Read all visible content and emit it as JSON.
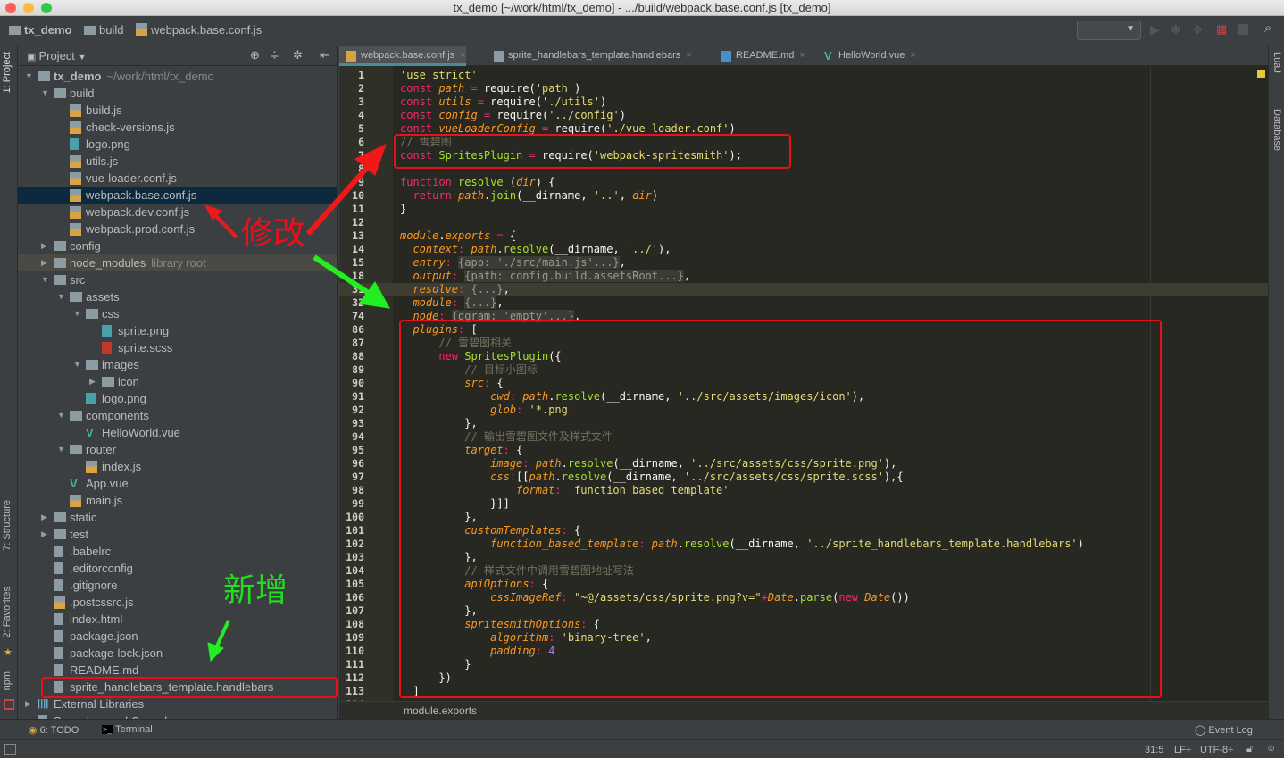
{
  "window": {
    "title": "tx_demo [~/work/html/tx_demo] - .../build/webpack.base.conf.js [tx_demo]"
  },
  "navbar": {
    "crumbs": [
      "tx_demo",
      "build",
      "webpack.base.conf.js"
    ]
  },
  "project": {
    "title": "Project",
    "items": [
      {
        "level": 0,
        "type": "folder",
        "open": true,
        "label": "tx_demo",
        "suffix": "~/work/html/tx_demo",
        "bold": true
      },
      {
        "level": 1,
        "type": "folder",
        "open": true,
        "label": "build"
      },
      {
        "level": 2,
        "type": "js",
        "label": "build.js"
      },
      {
        "level": 2,
        "type": "js",
        "label": "check-versions.js"
      },
      {
        "level": 2,
        "type": "img",
        "label": "logo.png"
      },
      {
        "level": 2,
        "type": "js",
        "label": "utils.js"
      },
      {
        "level": 2,
        "type": "js",
        "label": "vue-loader.conf.js"
      },
      {
        "level": 2,
        "type": "js",
        "label": "webpack.base.conf.js",
        "selected": true
      },
      {
        "level": 2,
        "type": "js",
        "label": "webpack.dev.conf.js"
      },
      {
        "level": 2,
        "type": "js",
        "label": "webpack.prod.conf.js"
      },
      {
        "level": 1,
        "type": "folder",
        "open": false,
        "label": "config"
      },
      {
        "level": 1,
        "type": "folder",
        "open": false,
        "label": "node_modules",
        "suffix": "library root",
        "lib": true
      },
      {
        "level": 1,
        "type": "folder",
        "open": true,
        "label": "src"
      },
      {
        "level": 2,
        "type": "folder",
        "open": true,
        "label": "assets"
      },
      {
        "level": 3,
        "type": "folder",
        "open": true,
        "label": "css"
      },
      {
        "level": 4,
        "type": "img",
        "label": "sprite.png"
      },
      {
        "level": 4,
        "type": "scss",
        "label": "sprite.scss"
      },
      {
        "level": 3,
        "type": "folder",
        "open": true,
        "label": "images"
      },
      {
        "level": 4,
        "type": "folder",
        "open": false,
        "label": "icon"
      },
      {
        "level": 3,
        "type": "img",
        "label": "logo.png"
      },
      {
        "level": 2,
        "type": "folder",
        "open": true,
        "label": "components"
      },
      {
        "level": 3,
        "type": "vue",
        "label": "HelloWorld.vue"
      },
      {
        "level": 2,
        "type": "folder",
        "open": true,
        "label": "router"
      },
      {
        "level": 3,
        "type": "js",
        "label": "index.js"
      },
      {
        "level": 2,
        "type": "vue",
        "label": "App.vue"
      },
      {
        "level": 2,
        "type": "js",
        "label": "main.js"
      },
      {
        "level": 1,
        "type": "folder",
        "open": false,
        "label": "static"
      },
      {
        "level": 1,
        "type": "folder",
        "open": false,
        "label": "test"
      },
      {
        "level": 1,
        "type": "file",
        "label": ".babelrc"
      },
      {
        "level": 1,
        "type": "file",
        "label": ".editorconfig"
      },
      {
        "level": 1,
        "type": "file",
        "label": ".gitignore"
      },
      {
        "level": 1,
        "type": "js",
        "label": ".postcssrc.js"
      },
      {
        "level": 1,
        "type": "file",
        "label": "index.html"
      },
      {
        "level": 1,
        "type": "file",
        "label": "package.json"
      },
      {
        "level": 1,
        "type": "file",
        "label": "package-lock.json"
      },
      {
        "level": 1,
        "type": "file",
        "label": "README.md"
      },
      {
        "level": 1,
        "type": "file",
        "label": "sprite_handlebars_template.handlebars"
      },
      {
        "level": 0,
        "type": "lib",
        "open": false,
        "label": "External Libraries"
      },
      {
        "level": 0,
        "type": "file",
        "label": "Scratches and Consoles"
      }
    ]
  },
  "tabs": [
    {
      "label": "webpack.base.conf.js",
      "active": true
    },
    {
      "label": "sprite_handlebars_template.handlebars"
    },
    {
      "label": "README.md"
    },
    {
      "label": "HelloWorld.vue"
    }
  ],
  "code": [
    {
      "n": "1",
      "t": [
        [
          "s",
          "'use strict'"
        ]
      ]
    },
    {
      "n": "2",
      "t": [
        [
          "k",
          "const "
        ],
        [
          "v",
          "path"
        ],
        [
          "o",
          " = "
        ],
        [
          "t",
          "require("
        ],
        [
          "s",
          "'path'"
        ],
        [
          "t",
          ")"
        ]
      ]
    },
    {
      "n": "3",
      "t": [
        [
          "k",
          "const "
        ],
        [
          "v",
          "utils"
        ],
        [
          "o",
          " = "
        ],
        [
          "t",
          "require("
        ],
        [
          "s",
          "'./utils'"
        ],
        [
          "t",
          ")"
        ]
      ]
    },
    {
      "n": "4",
      "t": [
        [
          "k",
          "const "
        ],
        [
          "v",
          "config"
        ],
        [
          "o",
          " = "
        ],
        [
          "t",
          "require("
        ],
        [
          "s",
          "'../config'"
        ],
        [
          "t",
          ")"
        ]
      ]
    },
    {
      "n": "5",
      "t": [
        [
          "k",
          "const "
        ],
        [
          "v",
          "vueLoaderConfig"
        ],
        [
          "o",
          " = "
        ],
        [
          "t",
          "require("
        ],
        [
          "s",
          "'./vue-loader.conf'"
        ],
        [
          "t",
          ")"
        ]
      ]
    },
    {
      "n": "6",
      "t": [
        [
          "c",
          "// 雪碧图"
        ]
      ]
    },
    {
      "n": "7",
      "t": [
        [
          "k",
          "const "
        ],
        [
          "cls",
          "SpritesPlugin"
        ],
        [
          "o",
          " = "
        ],
        [
          "t",
          "require("
        ],
        [
          "s",
          "'webpack-spritesmith'"
        ],
        [
          "t",
          ");"
        ]
      ]
    },
    {
      "n": "8",
      "t": []
    },
    {
      "n": "9",
      "t": [
        [
          "k",
          "function "
        ],
        [
          "f",
          "resolve "
        ],
        [
          "t",
          "("
        ],
        [
          "v",
          "dir"
        ],
        [
          "t",
          ") {"
        ]
      ]
    },
    {
      "n": "10",
      "t": [
        [
          "t",
          "  "
        ],
        [
          "k",
          "return "
        ],
        [
          "v",
          "path"
        ],
        [
          "t",
          "."
        ],
        [
          "f",
          "join"
        ],
        [
          "t",
          "(__dirname, "
        ],
        [
          "s",
          "'..'"
        ],
        [
          "t",
          ", "
        ],
        [
          "v",
          "dir"
        ],
        [
          "t",
          ")"
        ]
      ]
    },
    {
      "n": "11",
      "t": [
        [
          "t",
          "}"
        ]
      ]
    },
    {
      "n": "12",
      "t": []
    },
    {
      "n": "13",
      "t": [
        [
          "v",
          "module"
        ],
        [
          "t",
          "."
        ],
        [
          "v",
          "exports"
        ],
        [
          "o",
          " = "
        ],
        [
          "t",
          "{"
        ]
      ]
    },
    {
      "n": "14",
      "t": [
        [
          "t",
          "  "
        ],
        [
          "p",
          "context"
        ],
        [
          "o",
          ": "
        ],
        [
          "v",
          "path"
        ],
        [
          "t",
          "."
        ],
        [
          "f",
          "resolve"
        ],
        [
          "t",
          "(__dirname, "
        ],
        [
          "s",
          "'../'"
        ],
        [
          "t",
          "),"
        ]
      ]
    },
    {
      "n": "15",
      "t": [
        [
          "t",
          "  "
        ],
        [
          "p",
          "entry"
        ],
        [
          "o",
          ": "
        ],
        [
          "fd",
          "{app: './src/main.js'...}"
        ],
        [
          "t",
          ","
        ]
      ]
    },
    {
      "n": "18",
      "t": [
        [
          "t",
          "  "
        ],
        [
          "p",
          "output"
        ],
        [
          "o",
          ": "
        ],
        [
          "fd",
          "{path: config.build.assetsRoot...}"
        ],
        [
          "t",
          ","
        ]
      ]
    },
    {
      "n": "31",
      "cur": true,
      "t": [
        [
          "t",
          "  "
        ],
        [
          "p",
          "resolve"
        ],
        [
          "o",
          ": "
        ],
        [
          "fd",
          "{...}"
        ],
        [
          "t",
          ","
        ]
      ]
    },
    {
      "n": "32",
      "t": [
        [
          "t",
          "  "
        ],
        [
          "p",
          "module"
        ],
        [
          "o",
          ": "
        ],
        [
          "fd",
          "{...}"
        ],
        [
          "t",
          ","
        ]
      ]
    },
    {
      "n": "74",
      "t": [
        [
          "t",
          "  "
        ],
        [
          "p",
          "node"
        ],
        [
          "o",
          ": "
        ],
        [
          "fd",
          "{dgram: 'empty'...}"
        ],
        [
          "t",
          ","
        ]
      ]
    },
    {
      "n": "86",
      "t": [
        [
          "t",
          "  "
        ],
        [
          "p",
          "plugins"
        ],
        [
          "o",
          ": "
        ],
        [
          "t",
          "["
        ]
      ]
    },
    {
      "n": "87",
      "t": [
        [
          "t",
          "      "
        ],
        [
          "c",
          "// 雪碧图相关"
        ]
      ]
    },
    {
      "n": "88",
      "t": [
        [
          "t",
          "      "
        ],
        [
          "k",
          "new "
        ],
        [
          "cls",
          "SpritesPlugin"
        ],
        [
          "t",
          "({"
        ]
      ]
    },
    {
      "n": "89",
      "t": [
        [
          "t",
          "          "
        ],
        [
          "c",
          "// 目标小图标"
        ]
      ]
    },
    {
      "n": "90",
      "t": [
        [
          "t",
          "          "
        ],
        [
          "p",
          "src"
        ],
        [
          "o",
          ": "
        ],
        [
          "t",
          "{"
        ]
      ]
    },
    {
      "n": "91",
      "t": [
        [
          "t",
          "              "
        ],
        [
          "p",
          "cwd"
        ],
        [
          "o",
          ": "
        ],
        [
          "v",
          "path"
        ],
        [
          "t",
          "."
        ],
        [
          "f",
          "resolve"
        ],
        [
          "t",
          "(__dirname, "
        ],
        [
          "s",
          "'../src/assets/images/icon'"
        ],
        [
          "t",
          "),"
        ]
      ]
    },
    {
      "n": "92",
      "t": [
        [
          "t",
          "              "
        ],
        [
          "p",
          "glob"
        ],
        [
          "o",
          ": "
        ],
        [
          "s",
          "'*.png'"
        ]
      ]
    },
    {
      "n": "93",
      "t": [
        [
          "t",
          "          },"
        ]
      ]
    },
    {
      "n": "94",
      "t": [
        [
          "t",
          "          "
        ],
        [
          "c",
          "// 输出雪碧图文件及样式文件"
        ]
      ]
    },
    {
      "n": "95",
      "t": [
        [
          "t",
          "          "
        ],
        [
          "p",
          "target"
        ],
        [
          "o",
          ": "
        ],
        [
          "t",
          "{"
        ]
      ]
    },
    {
      "n": "96",
      "t": [
        [
          "t",
          "              "
        ],
        [
          "p",
          "image"
        ],
        [
          "o",
          ": "
        ],
        [
          "v",
          "path"
        ],
        [
          "t",
          "."
        ],
        [
          "f",
          "resolve"
        ],
        [
          "t",
          "(__dirname, "
        ],
        [
          "s",
          "'../src/assets/css/sprite.png'"
        ],
        [
          "t",
          "),"
        ]
      ]
    },
    {
      "n": "97",
      "t": [
        [
          "t",
          "              "
        ],
        [
          "p",
          "css"
        ],
        [
          "o",
          ":"
        ],
        [
          "t",
          "[["
        ],
        [
          "v",
          "path"
        ],
        [
          "t",
          "."
        ],
        [
          "f",
          "resolve"
        ],
        [
          "t",
          "(__dirname, "
        ],
        [
          "s",
          "'../src/assets/css/sprite.scss'"
        ],
        [
          "t",
          "),{"
        ]
      ]
    },
    {
      "n": "98",
      "t": [
        [
          "t",
          "                  "
        ],
        [
          "p",
          "format"
        ],
        [
          "o",
          ": "
        ],
        [
          "s",
          "'function_based_template'"
        ]
      ]
    },
    {
      "n": "99",
      "t": [
        [
          "t",
          "              }]]"
        ]
      ]
    },
    {
      "n": "100",
      "t": [
        [
          "t",
          "          },"
        ]
      ]
    },
    {
      "n": "101",
      "t": [
        [
          "t",
          "          "
        ],
        [
          "p",
          "customTemplates"
        ],
        [
          "o",
          ": "
        ],
        [
          "t",
          "{"
        ]
      ]
    },
    {
      "n": "102",
      "t": [
        [
          "t",
          "              "
        ],
        [
          "p",
          "function_based_template"
        ],
        [
          "o",
          ": "
        ],
        [
          "v",
          "path"
        ],
        [
          "t",
          "."
        ],
        [
          "f",
          "resolve"
        ],
        [
          "t",
          "(__dirname, "
        ],
        [
          "s",
          "'../sprite_handlebars_template.handlebars'"
        ],
        [
          "t",
          ")"
        ]
      ]
    },
    {
      "n": "103",
      "t": [
        [
          "t",
          "          },"
        ]
      ]
    },
    {
      "n": "104",
      "t": [
        [
          "t",
          "          "
        ],
        [
          "c",
          "// 样式文件中调用雪碧图地址写法"
        ]
      ]
    },
    {
      "n": "105",
      "t": [
        [
          "t",
          "          "
        ],
        [
          "p",
          "apiOptions"
        ],
        [
          "o",
          ": "
        ],
        [
          "t",
          "{"
        ]
      ]
    },
    {
      "n": "106",
      "t": [
        [
          "t",
          "              "
        ],
        [
          "p",
          "cssImageRef"
        ],
        [
          "o",
          ": "
        ],
        [
          "s",
          "\"~@/assets/css/sprite.png?v=\""
        ],
        [
          "o",
          "+"
        ],
        [
          "v",
          "Date"
        ],
        [
          "t",
          "."
        ],
        [
          "f",
          "parse"
        ],
        [
          "t",
          "("
        ],
        [
          "k",
          "new "
        ],
        [
          "v",
          "Date"
        ],
        [
          "t",
          "())"
        ]
      ]
    },
    {
      "n": "107",
      "t": [
        [
          "t",
          "          },"
        ]
      ]
    },
    {
      "n": "108",
      "t": [
        [
          "t",
          "          "
        ],
        [
          "p",
          "spritesmithOptions"
        ],
        [
          "o",
          ": "
        ],
        [
          "t",
          "{"
        ]
      ]
    },
    {
      "n": "109",
      "t": [
        [
          "t",
          "              "
        ],
        [
          "p",
          "algorithm"
        ],
        [
          "o",
          ": "
        ],
        [
          "s",
          "'binary-tree'"
        ],
        [
          "t",
          ","
        ]
      ]
    },
    {
      "n": "110",
      "t": [
        [
          "t",
          "              "
        ],
        [
          "p",
          "padding"
        ],
        [
          "o",
          ": "
        ],
        [
          "n",
          "4"
        ]
      ]
    },
    {
      "n": "111",
      "t": [
        [
          "t",
          "          }"
        ]
      ]
    },
    {
      "n": "112",
      "t": [
        [
          "t",
          "      })"
        ]
      ]
    },
    {
      "n": "113",
      "t": [
        [
          "t",
          "  ]"
        ]
      ]
    },
    {
      "n": "114",
      "t": []
    }
  ],
  "editor_breadcrumb": "module.exports",
  "left_strip": {
    "project": "1: Project",
    "structure": "7: Structure",
    "favorites": "2: Favorites",
    "npm": "npm"
  },
  "right_strip": {
    "luaj": "LuaJ",
    "database": "Database"
  },
  "toolwindows": {
    "todo": "6: TODO",
    "terminal": "Terminal",
    "event_log": "Event Log"
  },
  "status": {
    "position": "31:5",
    "line_sep": "LF÷",
    "encoding": "UTF-8÷"
  },
  "annotations": {
    "modify": "修改",
    "added": "新增",
    "modify_color": "#e8101a",
    "added_color": "#22dd22"
  }
}
